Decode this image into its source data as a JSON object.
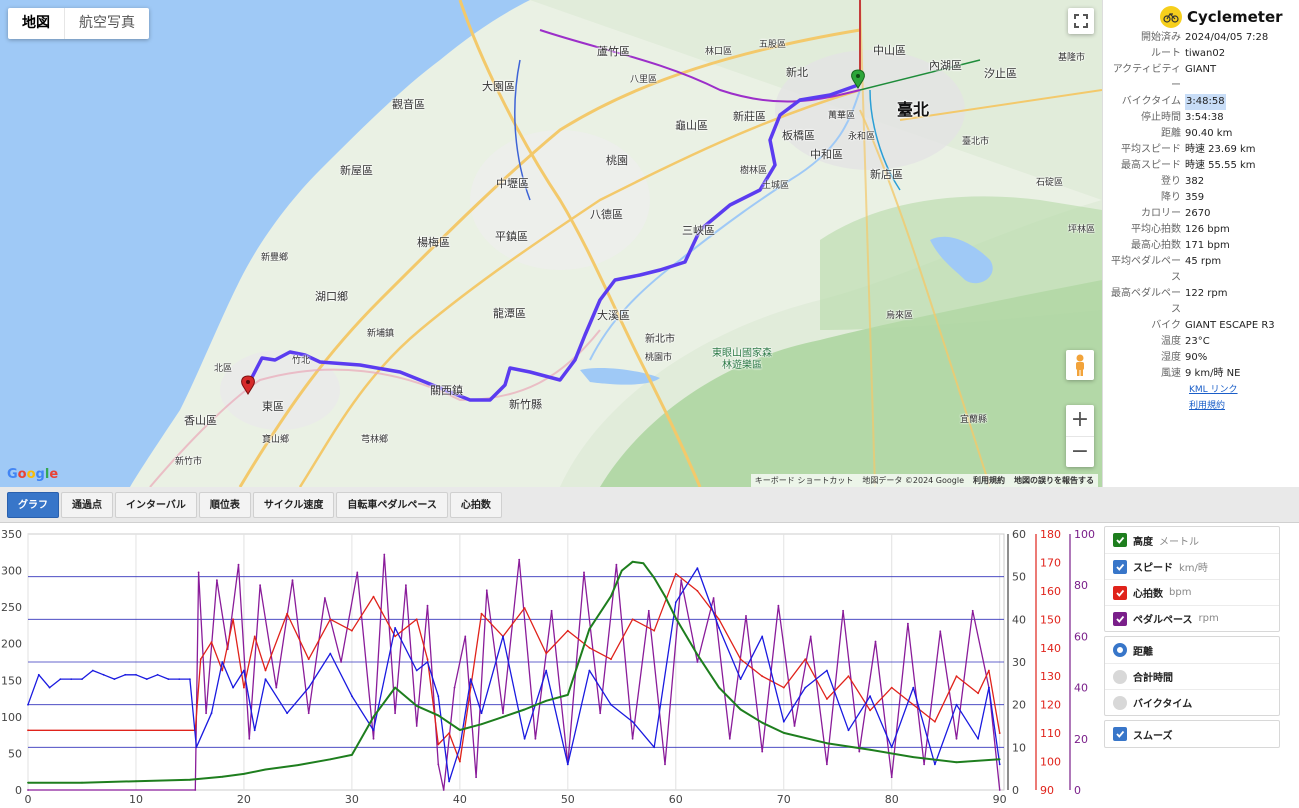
{
  "map": {
    "type_buttons": [
      {
        "label": "地図",
        "active": true
      },
      {
        "label": "航空写真",
        "active": false
      }
    ],
    "logo": "Google",
    "footer": {
      "keyboard": "キーボード ショートカット",
      "data": "地図データ ©2024 Google",
      "terms": "利用規約",
      "report": "地図の誤りを報告する"
    },
    "places": [
      "大園區",
      "蘆竹區",
      "觀音區",
      "新屋區",
      "中壢區",
      "桃園",
      "龜山區",
      "新莊區",
      "板橋區",
      "中和區",
      "臺北",
      "新北",
      "內湖區",
      "汐止區",
      "中山區",
      "萬華區",
      "永和區",
      "新店區",
      "樹林區",
      "土城區",
      "三峽區",
      "八德區",
      "平鎮區",
      "楊梅區",
      "湖口鄉",
      "新豐鄉",
      "北區",
      "竹北",
      "新埔鎮",
      "關西鎮",
      "龍潭區",
      "大溪區",
      "新竹縣",
      "東區",
      "香山區",
      "寶山鄉",
      "芎林鄉",
      "烏來區",
      "坪林區",
      "石碇區",
      "新北市",
      "桃園市",
      "新竹市",
      "五股區",
      "林口區",
      "八里區",
      "宜蘭縣",
      "東眼山國家森林遊樂區",
      "臺北市",
      "基隆市"
    ]
  },
  "info": {
    "app_name": "Cyclemeter",
    "rows": [
      {
        "key": "開始済み",
        "value": "2024/04/05 7:28"
      },
      {
        "key": "ルート",
        "value": "tiwan02"
      },
      {
        "key": "アクティビティー",
        "value": "GIANT"
      },
      {
        "key": "バイクタイム",
        "value": "3:48:58",
        "selected": true
      },
      {
        "key": "停止時間",
        "value": "3:54:38"
      },
      {
        "key": "距離",
        "value": "90.40 km"
      },
      {
        "key": "平均スピード",
        "value": "時速 23.69 km"
      },
      {
        "key": "最高スピード",
        "value": "時速 55.55 km"
      },
      {
        "key": "登り",
        "value": "382"
      },
      {
        "key": "降り",
        "value": "359"
      },
      {
        "key": "カロリー",
        "value": "2670"
      },
      {
        "key": "平均心拍数",
        "value": "126 bpm"
      },
      {
        "key": "最高心拍数",
        "value": "171 bpm"
      },
      {
        "key": "平均ペダルペース",
        "value": "45 rpm"
      },
      {
        "key": "最高ペダルペース",
        "value": "122 rpm"
      },
      {
        "key": "バイク",
        "value": "GIANT ESCAPE R3"
      },
      {
        "key": "温度",
        "value": "23°C"
      },
      {
        "key": "湿度",
        "value": "90%"
      },
      {
        "key": "風速",
        "value": "9 km/時 NE"
      }
    ],
    "links": [
      "KML リンク",
      "利用規約"
    ]
  },
  "tabs": [
    {
      "label": "グラフ",
      "active": true
    },
    {
      "label": "通過点"
    },
    {
      "label": "インターバル"
    },
    {
      "label": "順位表"
    },
    {
      "label": "サイクル速度"
    },
    {
      "label": "自転車ペダルペース"
    },
    {
      "label": "心拍数"
    }
  ],
  "legend": {
    "series": [
      {
        "label": "高度",
        "unit": "メートル",
        "color": "#1e7e1e",
        "checked": true
      },
      {
        "label": "スピード",
        "unit": "km/時",
        "color": "#3876c9",
        "checked": true
      },
      {
        "label": "心拍数",
        "unit": "bpm",
        "color": "#e0231b",
        "checked": true
      },
      {
        "label": "ペダルペース",
        "unit": "rpm",
        "color": "#7a1f8a",
        "checked": true
      }
    ],
    "x_modes": [
      {
        "label": "距離",
        "selected": true
      },
      {
        "label": "合計時間",
        "selected": false
      },
      {
        "label": "バイクタイム",
        "selected": false
      }
    ],
    "smooth": {
      "label": "スムーズ",
      "checked": true
    }
  },
  "chart_data": {
    "type": "line",
    "x": {
      "ticks": [
        0,
        10,
        20,
        30,
        40,
        50,
        60,
        70,
        80,
        90
      ],
      "range": [
        0,
        90.4
      ]
    },
    "axes": {
      "altitude": {
        "ticks": [
          0,
          50,
          100,
          150,
          200,
          250,
          300,
          350
        ],
        "range": [
          0,
          350
        ],
        "color": "#444"
      },
      "speed": {
        "ticks": [
          0,
          10,
          20,
          30,
          40,
          50,
          60
        ],
        "range": [
          0,
          60
        ],
        "color": "#444"
      },
      "heart_rate": {
        "ticks": [
          90,
          100,
          110,
          120,
          130,
          140,
          150,
          160,
          170,
          180
        ],
        "range": [
          90,
          180
        ],
        "color": "#e0231b"
      },
      "cadence": {
        "ticks": [
          0,
          20,
          40,
          60,
          80,
          100
        ],
        "range": [
          0,
          100
        ],
        "color": "#7a1f8a"
      }
    },
    "grid_color": "#3333bb",
    "series": [
      {
        "name": "高度",
        "axis": "altitude",
        "color": "#1e7e1e",
        "x": [
          0,
          5,
          10,
          15,
          18,
          20,
          22,
          25,
          28,
          30,
          32,
          34,
          36,
          38,
          40,
          42,
          44,
          46,
          48,
          50,
          52,
          54,
          55,
          56,
          57,
          58,
          59,
          60,
          62,
          64,
          66,
          68,
          70,
          74,
          78,
          82,
          86,
          90
        ],
        "y": [
          10,
          10,
          12,
          14,
          18,
          22,
          28,
          34,
          42,
          48,
          100,
          140,
          115,
          102,
          82,
          90,
          100,
          110,
          122,
          130,
          220,
          265,
          300,
          312,
          310,
          290,
          265,
          235,
          185,
          140,
          110,
          92,
          78,
          64,
          55,
          45,
          38,
          42
        ]
      },
      {
        "name": "スピード",
        "axis": "speed",
        "color": "#1a1ae0",
        "x": [
          0,
          1,
          2,
          3,
          4,
          5,
          6,
          7,
          8,
          9,
          10,
          11,
          12,
          13,
          14,
          15,
          15.6,
          17,
          18,
          19,
          20,
          21,
          22,
          24,
          26,
          28,
          30,
          32,
          34,
          36,
          37,
          38,
          39,
          40,
          41,
          42,
          44,
          46,
          48,
          50,
          52,
          54,
          56,
          58,
          60,
          62,
          64,
          66,
          68,
          70,
          72,
          74,
          76,
          78,
          80,
          82,
          84,
          86,
          88,
          89,
          90
        ],
        "y": [
          20,
          27,
          24,
          26,
          26,
          26,
          28,
          27,
          26,
          27,
          27,
          26,
          27,
          26,
          26,
          26,
          10,
          18,
          30,
          24,
          28,
          14,
          26,
          18,
          24,
          32,
          22,
          14,
          38,
          28,
          30,
          22,
          2,
          10,
          26,
          18,
          36,
          12,
          28,
          6,
          28,
          20,
          16,
          10,
          44,
          52,
          38,
          26,
          36,
          16,
          24,
          28,
          14,
          22,
          10,
          24,
          6,
          20,
          12,
          24,
          6
        ]
      },
      {
        "name": "心拍数",
        "axis": "heart_rate",
        "color": "#e0231b",
        "x": [
          0,
          15.5,
          16,
          17,
          18,
          19,
          20,
          21,
          22,
          24,
          26,
          28,
          30,
          32,
          34,
          36,
          37,
          38,
          39,
          40,
          41,
          42,
          44,
          46,
          48,
          50,
          52,
          54,
          56,
          58,
          60,
          62,
          64,
          66,
          68,
          70,
          72,
          74,
          76,
          78,
          80,
          82,
          84,
          86,
          88,
          89,
          90
        ],
        "y": [
          111,
          111,
          136,
          142,
          132,
          150,
          126,
          144,
          132,
          152,
          136,
          150,
          146,
          158,
          144,
          150,
          136,
          106,
          110,
          100,
          126,
          152,
          144,
          154,
          138,
          146,
          140,
          136,
          150,
          146,
          166,
          160,
          150,
          136,
          130,
          126,
          136,
          122,
          130,
          118,
          126,
          120,
          114,
          130,
          124,
          132,
          110
        ]
      },
      {
        "name": "ペダルペース",
        "axis": "cadence",
        "color": "#8a1c9a",
        "x": [
          0,
          15.5,
          15.8,
          16.5,
          17.5,
          18.5,
          19.5,
          20.5,
          21.5,
          23,
          24.5,
          26,
          27.5,
          29,
          30.5,
          32,
          33,
          34,
          35,
          36,
          37,
          38,
          38.5,
          39.5,
          40.5,
          41.5,
          42.5,
          44,
          45.5,
          47,
          48.5,
          50,
          51.5,
          53,
          54.5,
          56,
          57.5,
          59,
          60.5,
          62,
          63.5,
          65,
          66.5,
          68,
          69.5,
          71,
          72.5,
          74,
          75.5,
          77,
          78.5,
          80,
          81.5,
          83,
          84.5,
          86,
          87.5,
          89,
          90
        ],
        "y": [
          0,
          0,
          85,
          30,
          82,
          55,
          88,
          20,
          80,
          40,
          82,
          30,
          75,
          50,
          85,
          20,
          92,
          30,
          80,
          25,
          72,
          10,
          0,
          40,
          60,
          5,
          78,
          30,
          90,
          20,
          70,
          10,
          85,
          30,
          88,
          20,
          70,
          10,
          82,
          50,
          75,
          20,
          68,
          15,
          72,
          25,
          60,
          10,
          70,
          15,
          58,
          5,
          65,
          10,
          62,
          20,
          70,
          40,
          0
        ]
      }
    ]
  }
}
